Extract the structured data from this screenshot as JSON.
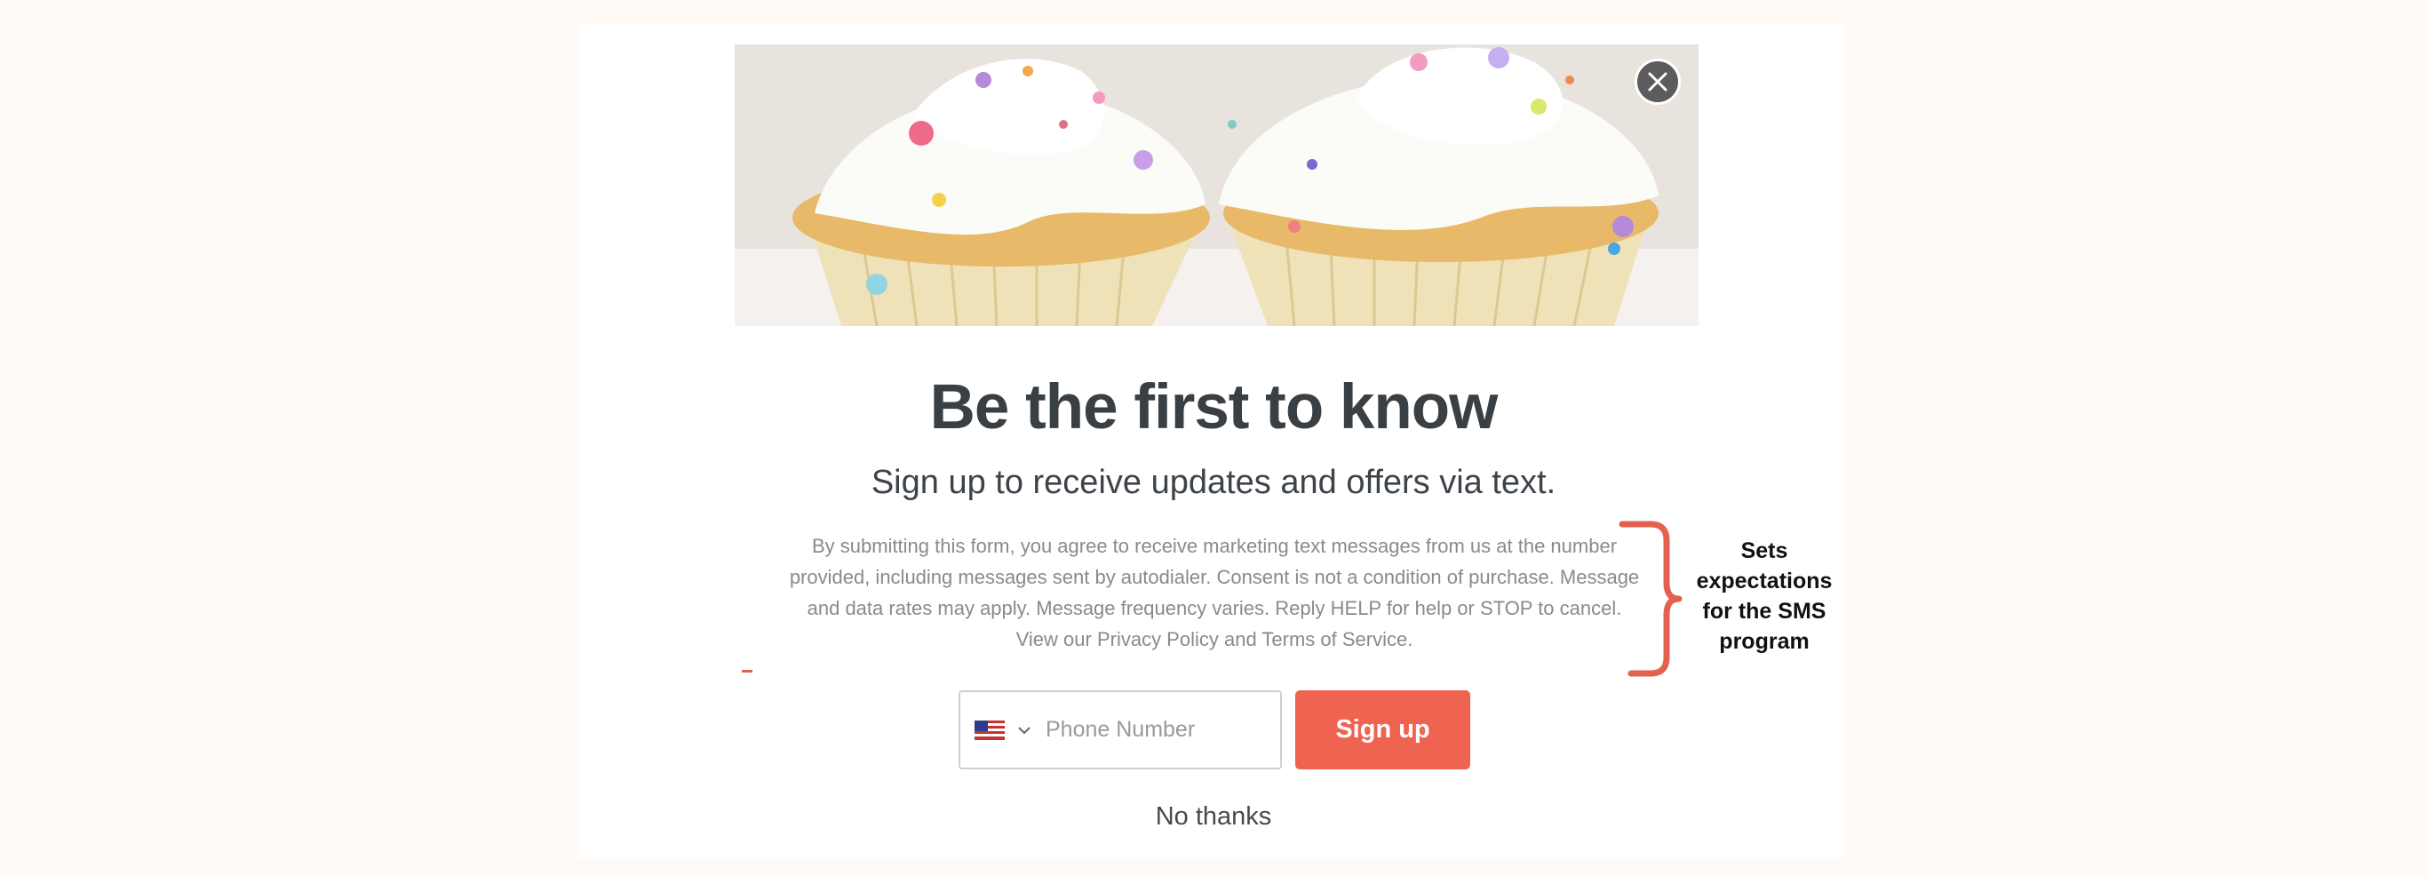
{
  "hero": {
    "image_alt": "Cupcakes with white frosting and colorful sprinkles"
  },
  "close_icon": "close-icon",
  "title": "Be the first to know",
  "subtitle": "Sign up to receive updates and offers via text.",
  "legal_text": "By submitting this form, you agree to receive marketing text messages from us at the number provided, including messages sent by autodialer. Consent is not a condition of purchase. Message and data rates may apply. Message frequency varies. Reply HELP for help or STOP to cancel. View our Privacy Policy and Terms of Service.",
  "annotation": "Sets expectations for the SMS program",
  "phone": {
    "country_flag": "us-flag-icon",
    "placeholder": "Phone Number",
    "value": ""
  },
  "signup_label": "Sign up",
  "no_thanks_label": "No thanks",
  "colors": {
    "accent": "#ef6351",
    "annotation_bracket": "#e2624f",
    "page_background": "#fffaf6",
    "title_text": "#3a3f44"
  }
}
